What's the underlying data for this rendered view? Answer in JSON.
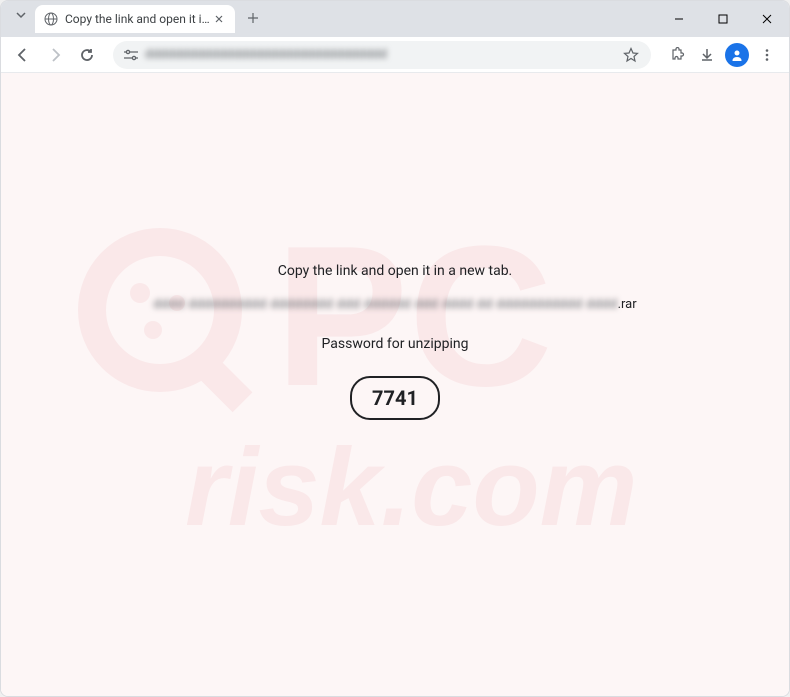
{
  "browser": {
    "tab": {
      "title": "Copy the link and open it in a n",
      "url_blurred": "ddddddddddddddddddddddddddddddddd"
    }
  },
  "page": {
    "instruction": "Copy the link and open it in a new tab.",
    "link_blurred": "dddd dddddddddd dddddddd ddd dddddd ddd dddd dd ddddddddddd dddd",
    "link_suffix": ".rar",
    "password_label": "Password for unzipping",
    "password_value": "7741"
  },
  "watermark": {
    "line1": "PC",
    "line2": "risk.com"
  }
}
